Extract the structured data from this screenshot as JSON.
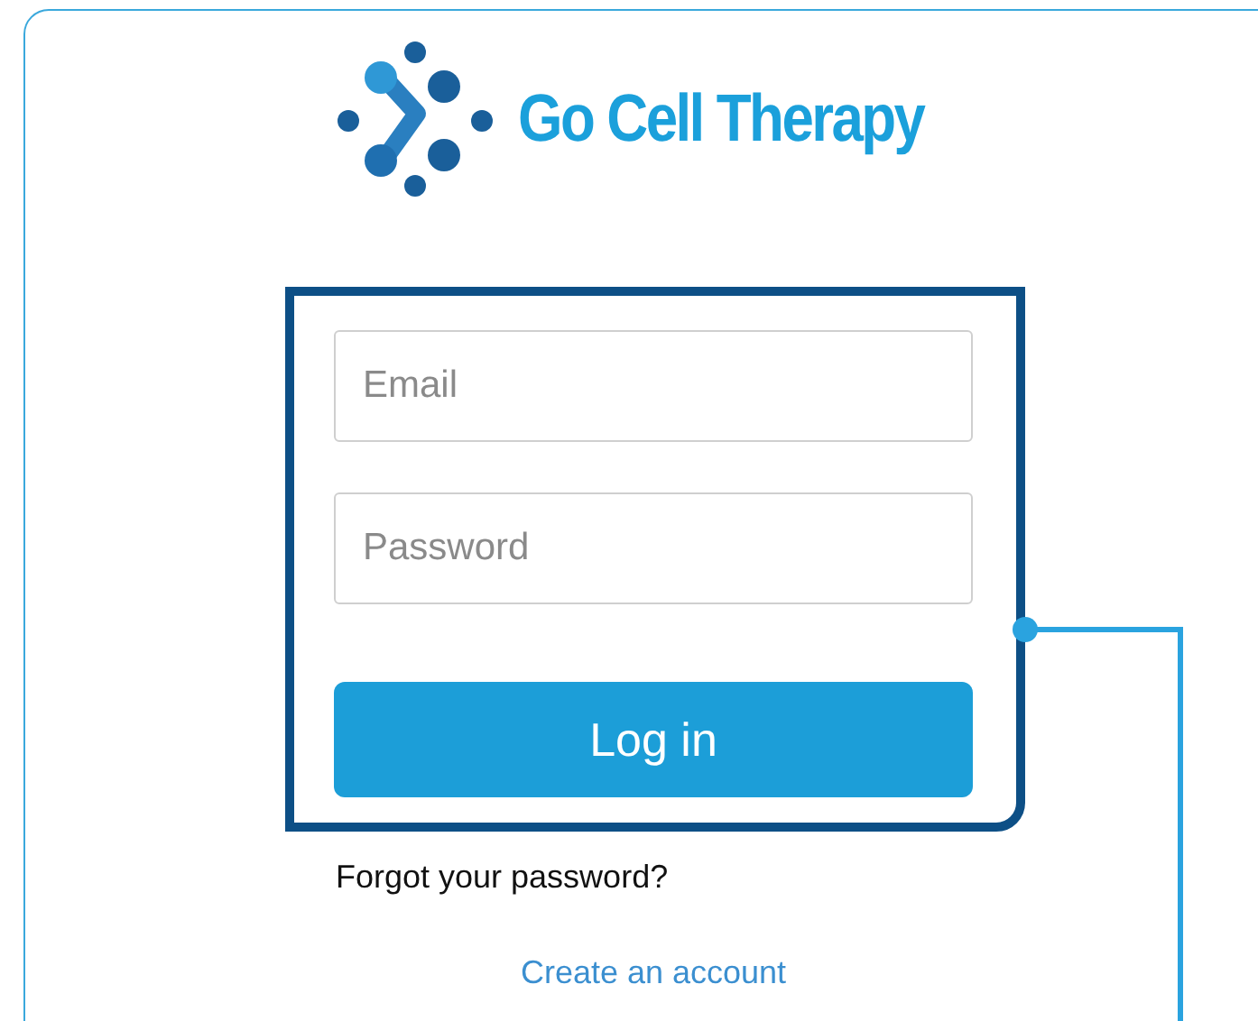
{
  "logo": {
    "text": "Go Cell Therapy"
  },
  "form": {
    "email": {
      "placeholder": "Email"
    },
    "password": {
      "placeholder": "Password"
    },
    "submit": "Log in"
  },
  "forgot_link": "Forgot your password?",
  "create_account_link": "Create an account"
}
